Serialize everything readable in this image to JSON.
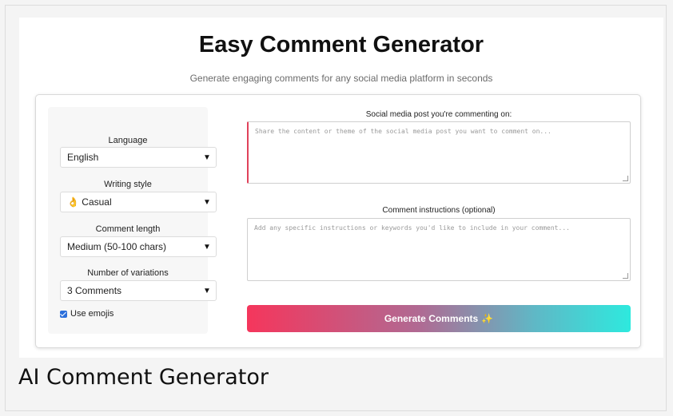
{
  "header": {
    "title": "Easy Comment Generator",
    "subtitle": "Generate engaging comments for any social media platform in seconds"
  },
  "settings": {
    "language": {
      "label": "Language",
      "value": "English"
    },
    "writing_style": {
      "label": "Writing style",
      "value": "👌 Casual"
    },
    "comment_length": {
      "label": "Comment length",
      "value": "Medium (50-100 chars)"
    },
    "variations": {
      "label": "Number of variations",
      "value": "3 Comments"
    },
    "emojis": {
      "label": "Use emojis",
      "checked": true
    }
  },
  "post": {
    "label": "Social media post you're commenting on:",
    "placeholder": "Share the content or theme of the social media post you want to comment on..."
  },
  "instructions": {
    "label": "Comment instructions (optional)",
    "placeholder": "Add any specific instructions or keywords you'd like to include in your comment..."
  },
  "generate": {
    "label": "Generate Comments",
    "icon": "✨"
  },
  "footer": {
    "title": "AI Comment Generator"
  },
  "colors": {
    "accent_start": "#f5365c",
    "accent_end": "#2ee9de",
    "checkbox": "#2c6fdb"
  }
}
